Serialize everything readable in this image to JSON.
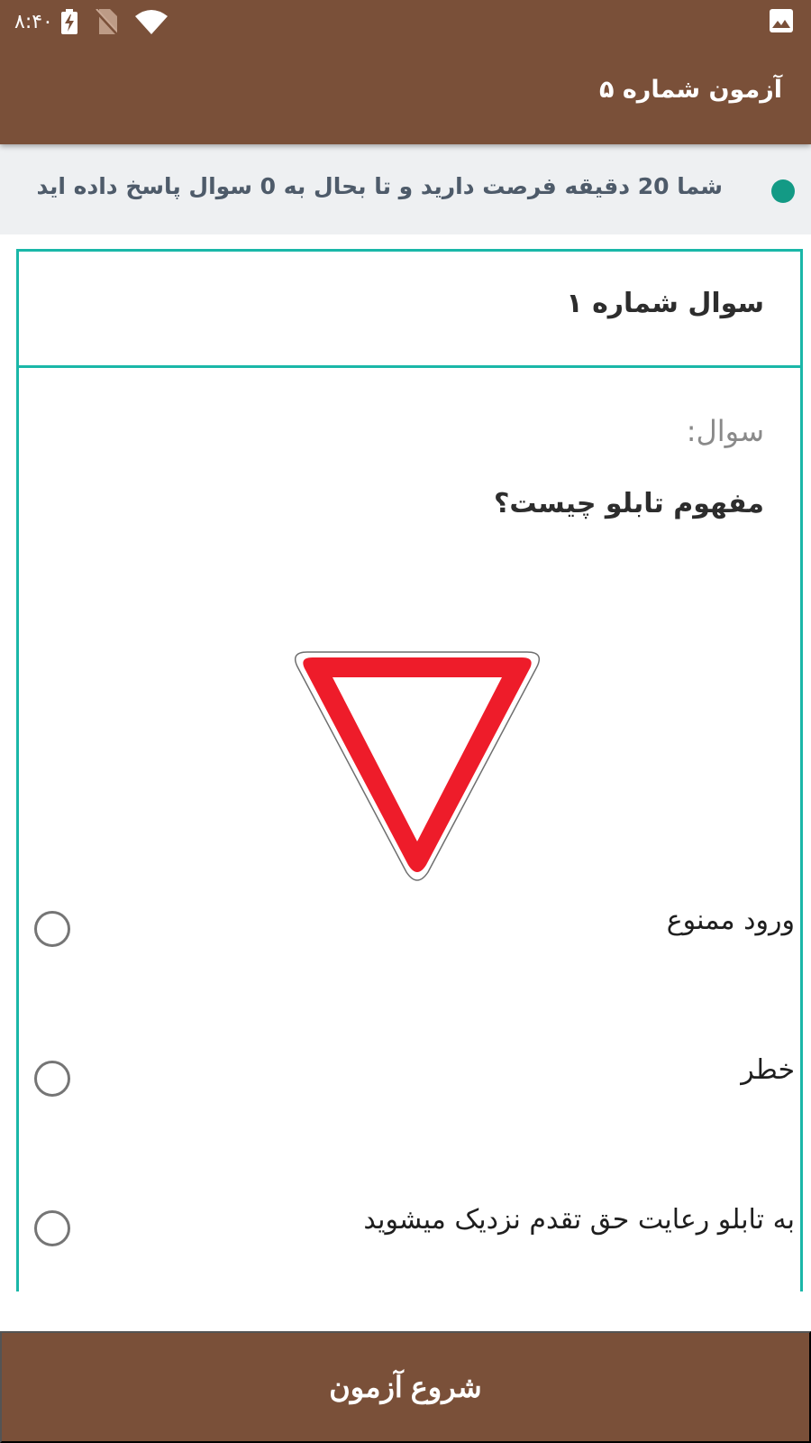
{
  "status_bar": {
    "time": "۸:۴۰",
    "icons": [
      "battery-charging-icon",
      "no-sim-icon",
      "wifi-icon",
      "image-notification-icon"
    ]
  },
  "appbar": {
    "title": "آزمون شماره ۵"
  },
  "info": {
    "text": "شما 20 دقیقه فرصت دارید و تا بحال به 0 سوال پاسخ داده اید",
    "dot_color": "#139a85"
  },
  "question": {
    "header": "سوال شماره ۱",
    "label": "سوال:",
    "text": "مفهوم تابلو چیست؟",
    "image": "yield-sign-icon",
    "options": [
      {
        "label": "ورود ممنوع",
        "selected": false
      },
      {
        "label": "خطر",
        "selected": false
      },
      {
        "label": "به تابلو رعایت حق تقدم نزدیک میشوید",
        "selected": false
      }
    ]
  },
  "footer": {
    "start_button": "شروع آزمون"
  },
  "colors": {
    "primary": "#7a5039",
    "accent": "#1ab7a8",
    "info_bg": "#eef0f2"
  }
}
